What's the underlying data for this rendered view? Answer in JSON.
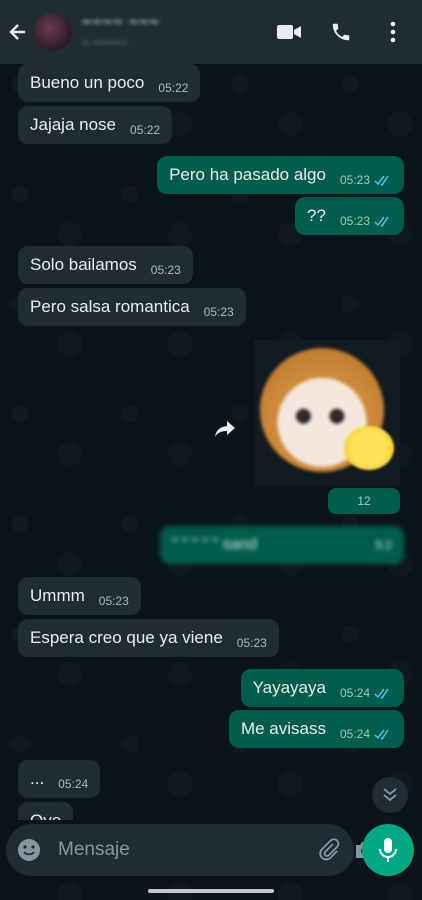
{
  "header": {
    "contact_name": "~~~~ ~~~",
    "contact_status": "~ ~~~~~"
  },
  "messages": [
    {
      "text": "Bueno un poco",
      "time": "05:22"
    },
    {
      "text": "Jajaja nose",
      "time": "05:22"
    },
    {
      "text": "Pero ha pasado algo",
      "time": "05:23"
    },
    {
      "text": "??",
      "time": "05:23"
    },
    {
      "text": "Solo bailamos",
      "time": "05:23"
    },
    {
      "text": "Pero salsa romantica",
      "time": "05:23"
    },
    {
      "text": "Ummm",
      "time": "05:23"
    },
    {
      "text": "Espera creo que ya viene",
      "time": "05:23"
    },
    {
      "text": "Yayayaya",
      "time": "05:24"
    },
    {
      "text": "Me avisass",
      "time": "05:24"
    },
    {
      "text": "...",
      "time": "05:24"
    },
    {
      "text": "Oye",
      "time": ""
    }
  ],
  "sticker": {
    "time": "12"
  },
  "blurred": {
    "text": "\" \" \"  \" \" sand  ",
    "time": "5:2"
  },
  "composer": {
    "placeholder": "Mensaje"
  },
  "colors": {
    "background": "#0b141a",
    "incoming_bubble": "#1f2c34",
    "outgoing_bubble": "#005c4b",
    "accent": "#00a884",
    "read_ticks": "#53bdeb"
  }
}
